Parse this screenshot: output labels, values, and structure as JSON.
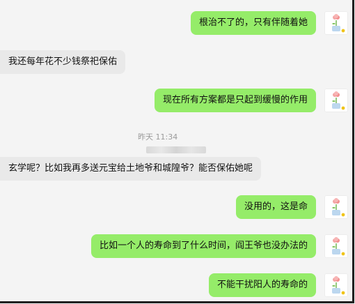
{
  "chat": {
    "messages": [
      {
        "text": "根治不了的，只有伴随着她"
      },
      {
        "text": "我还每年花不少钱祭祀保佑"
      },
      {
        "text": "现在所有方案都是只起到缓慢的作用"
      },
      {
        "text": "玄学呢？比如我再多送元宝给土地爷和城隍爷？能否保佑她呢"
      },
      {
        "text": "没用的，这是命"
      },
      {
        "text": "比如一个人的寿命到了什么时间，阎王爷也没办法的"
      },
      {
        "text": "不能干扰阳人的寿命的"
      }
    ],
    "timestamp": "昨天 11:34"
  },
  "colors": {
    "outgoing_bubble": "#95ec69",
    "incoming_bubble": "#e9e9e9",
    "background": "#f4f4f4"
  },
  "icons": {
    "avatar": "flower-pot-avatar-icon"
  }
}
